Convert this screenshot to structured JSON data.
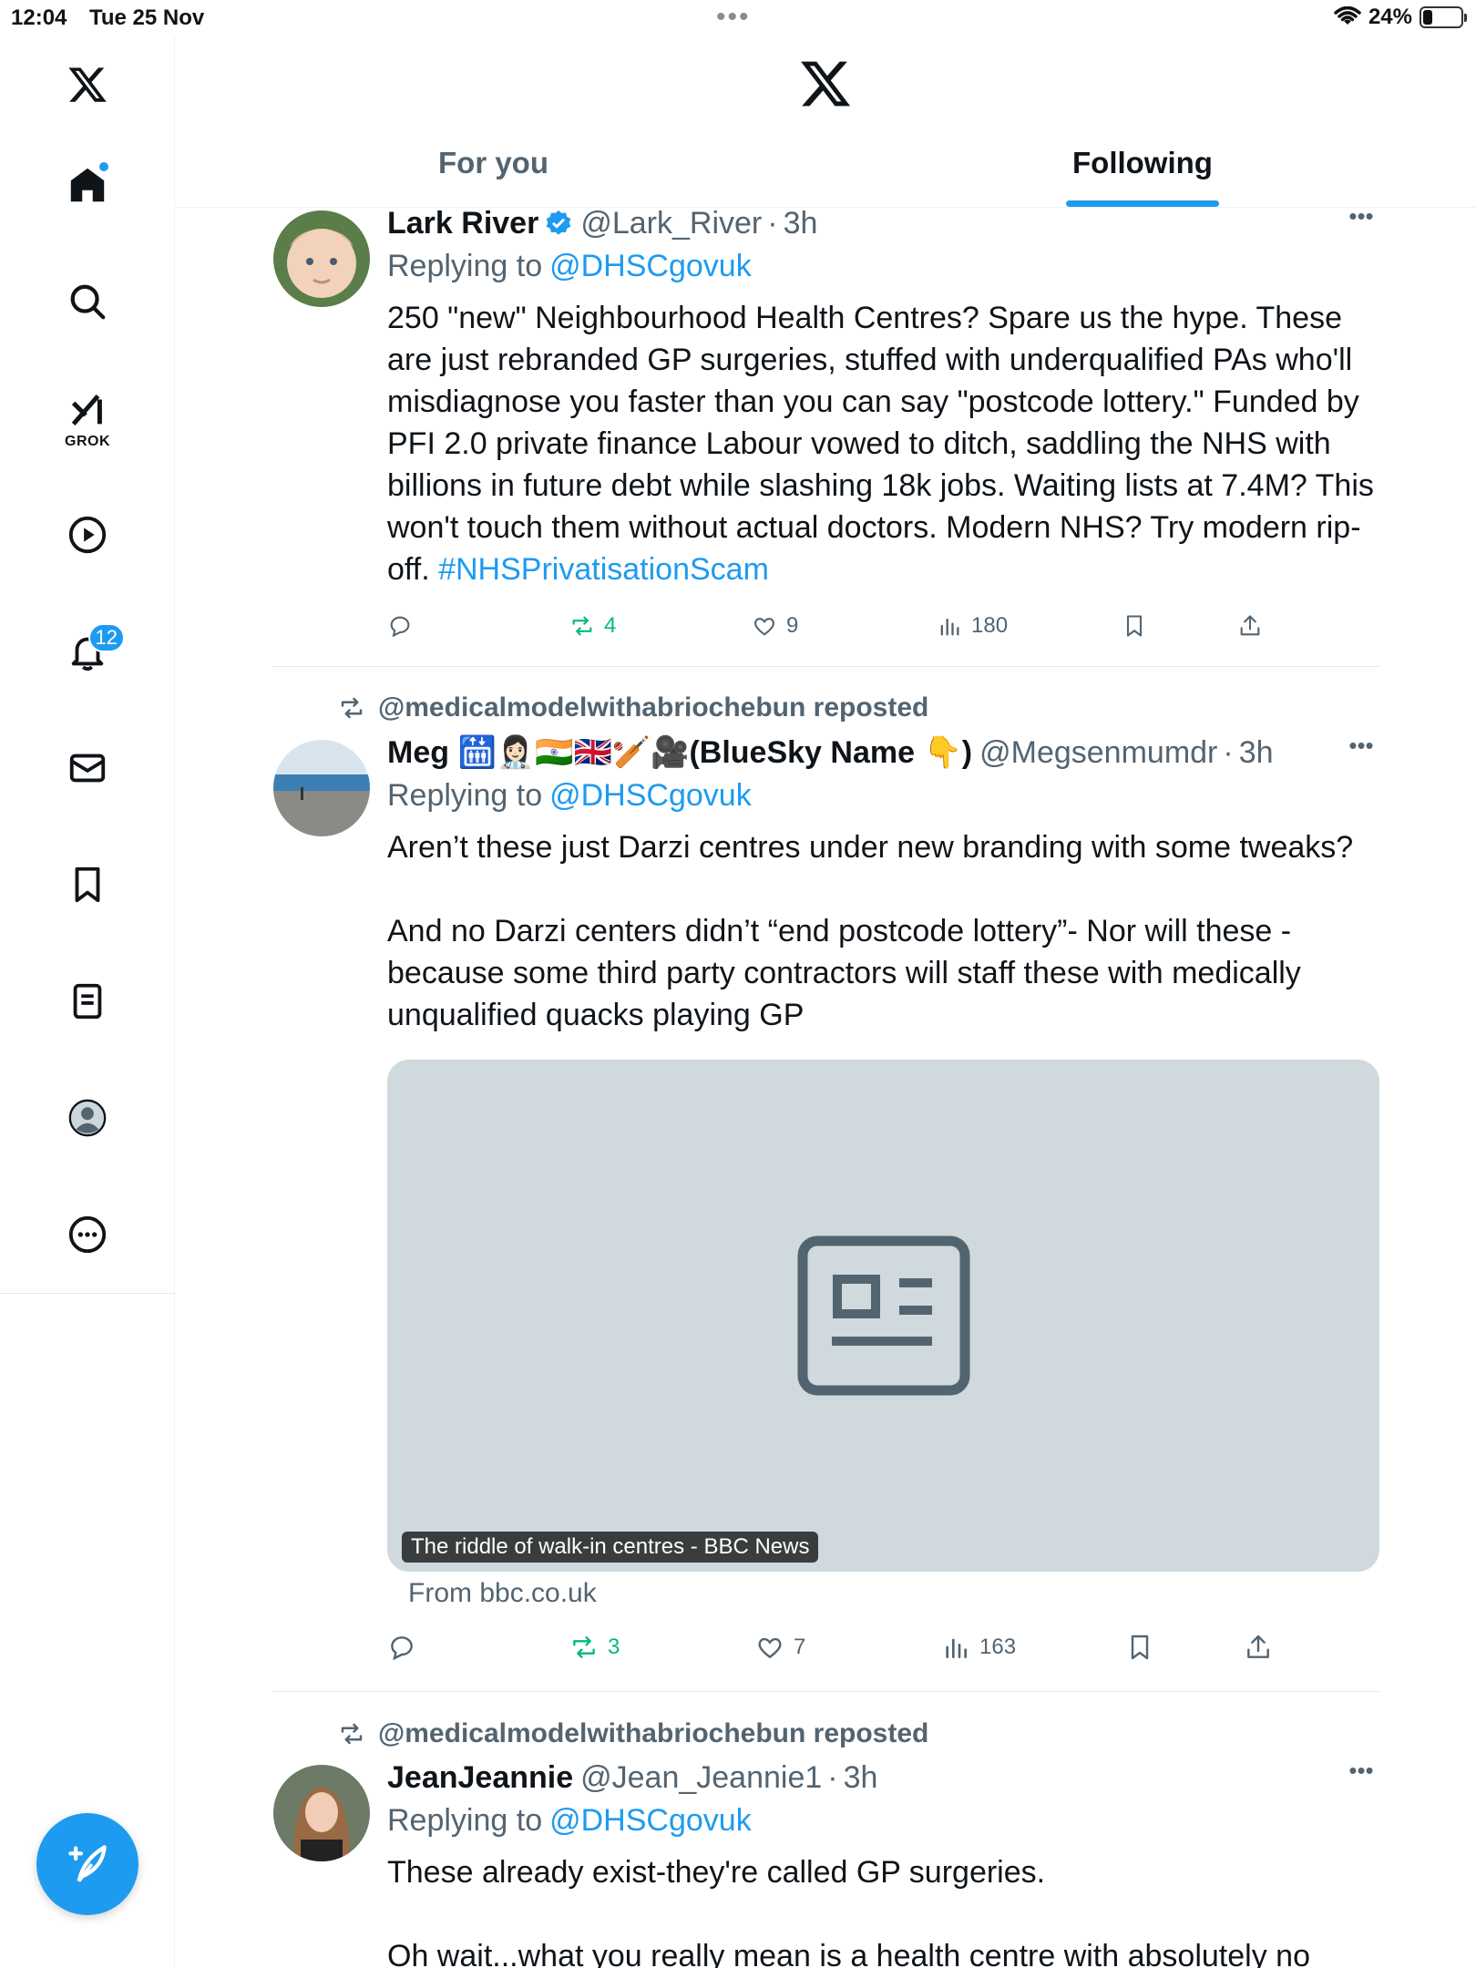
{
  "status_bar": {
    "time": "12:04",
    "date": "Tue 25 Nov",
    "battery": "24%",
    "battery_level": 0.24
  },
  "sidebar": {
    "grok_label": "GROK",
    "notifications_count": "12",
    "icons": [
      "x-logo-icon",
      "home-icon",
      "search-icon",
      "grok-icon",
      "video-icon",
      "bell-icon",
      "mail-icon",
      "bookmark-icon",
      "lists-icon",
      "profile-icon",
      "more-icon"
    ]
  },
  "header": {
    "tabs": [
      {
        "label": "For you",
        "active": false
      },
      {
        "label": "Following",
        "active": true
      }
    ]
  },
  "posts": [
    {
      "name": "Lark River",
      "verified": true,
      "handle": "@Lark_River",
      "time": "3h",
      "replying_to_label": "Replying to",
      "replying_to": "@DHSCgovuk",
      "text": "250 \"new\" Neighbourhood Health Centres? Spare us the hype. These are just rebranded GP surgeries, stuffed with underqualified PAs who'll misdiagnose you faster than you can say \"postcode lottery.\" Funded by PFI 2.0 private finance Labour vowed to ditch, saddling the NHS with billions in future debt while slashing 18k jobs. Waiting lists at 7.4M? This won't touch them without actual doctors. Modern NHS? Try modern rip-off.",
      "hashtag": "#NHSPrivatisationScam",
      "stats": {
        "reposts": "4",
        "likes": "9",
        "views": "180"
      }
    },
    {
      "repost_by": "@medicalmodelwithabriochebun reposted",
      "name": "Meg 🛗👩🏻‍⚕️🇮🇳🇬🇧🏏🎥(BlueSky Name 👇)",
      "handle": "@Megsenmumdr",
      "time": "3h",
      "replying_to_label": "Replying to",
      "replying_to": "@DHSCgovuk",
      "text": "Aren’t these just Darzi centres under new branding with some tweaks?\n\nAnd no Darzi centers didn’t “end postcode lottery”- Nor will these - because some third party contractors will staff these with medically unqualified quacks playing GP",
      "card": {
        "title": "The riddle of walk-in centres - BBC News",
        "from": "From bbc.co.uk"
      },
      "stats": {
        "reposts": "3",
        "likes": "7",
        "views": "163"
      }
    },
    {
      "repost_by": "@medicalmodelwithabriochebun reposted",
      "name": "JeanJeannie",
      "handle": "@Jean_Jeannie1",
      "time": "3h",
      "replying_to_label": "Replying to",
      "replying_to": "@DHSCgovuk",
      "text": "These already exist-they're called GP surgeries.\n\nOh wait...what you really mean is a health centre with absolutely no"
    }
  ],
  "colors": {
    "accent": "#1d9bf0",
    "repost_green": "#00ba7c",
    "muted": "#536471",
    "card_bg": "#cfd9de"
  }
}
